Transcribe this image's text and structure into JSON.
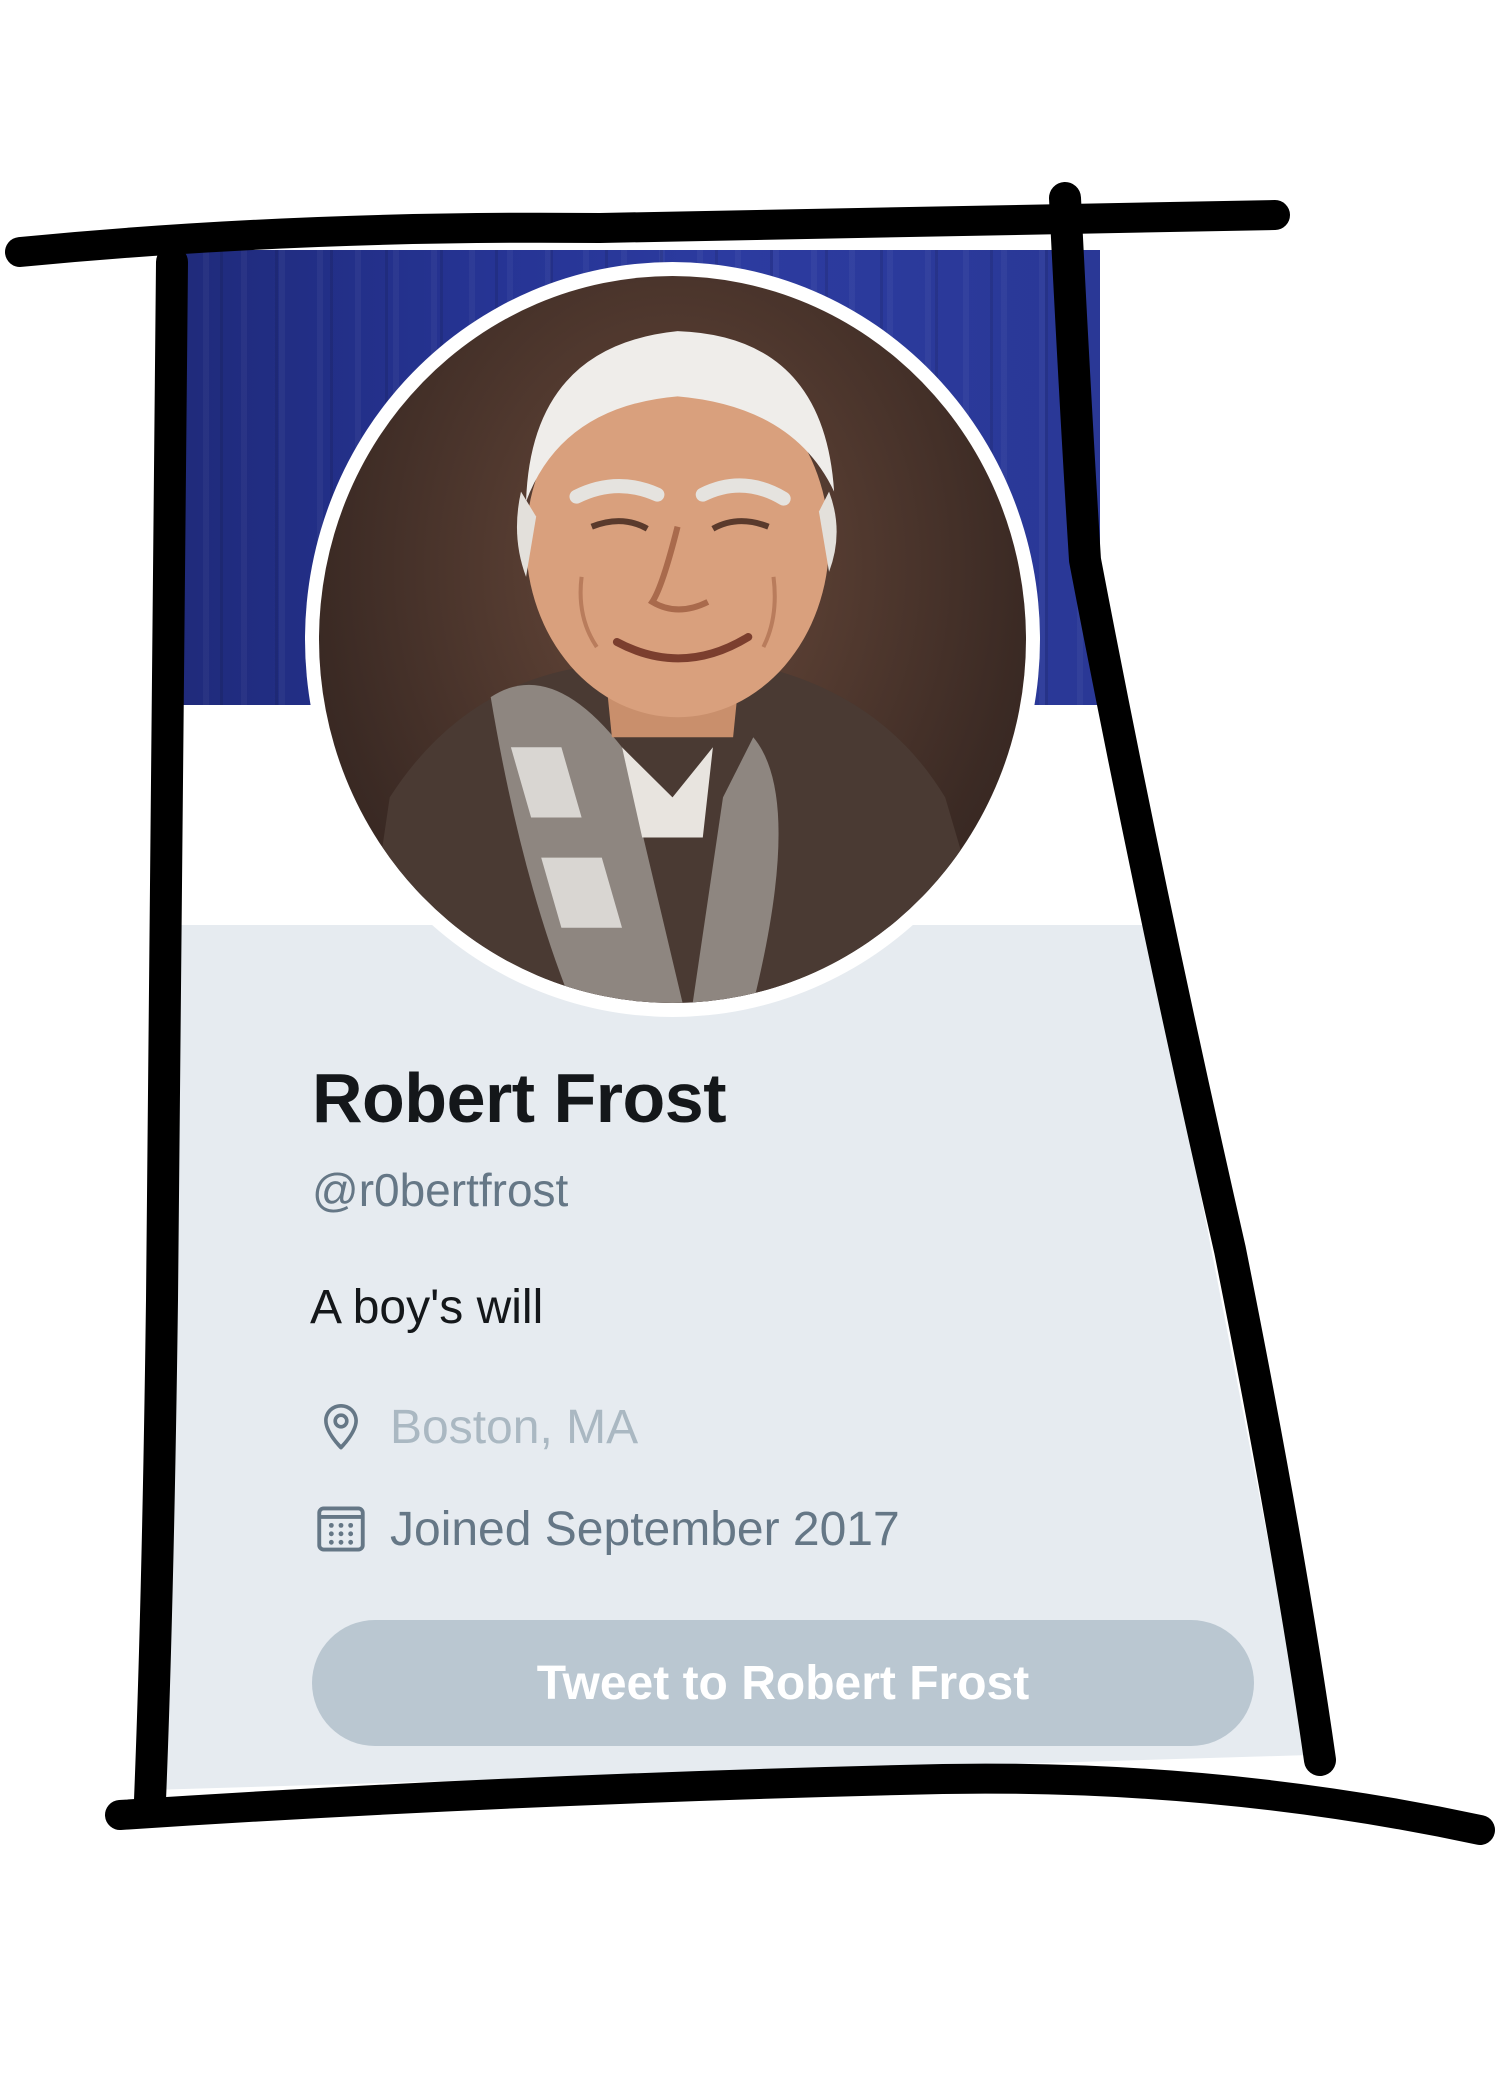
{
  "profile": {
    "name": "Robert Frost",
    "handle": "@r0bertfrost",
    "bio": "A boy's will",
    "location": "Boston, MA",
    "joined": "Joined September 2017",
    "location_icon": "location-pin-icon",
    "joined_icon": "calendar-icon"
  },
  "actions": {
    "tweet_button_label": "Tweet to Robert Frost"
  },
  "colors": {
    "banner": "#263494",
    "panel": "#e6ebf0",
    "button": "#bac7d1",
    "name": "#14171a",
    "secondary": "#657786",
    "muted": "#aab8c2"
  }
}
